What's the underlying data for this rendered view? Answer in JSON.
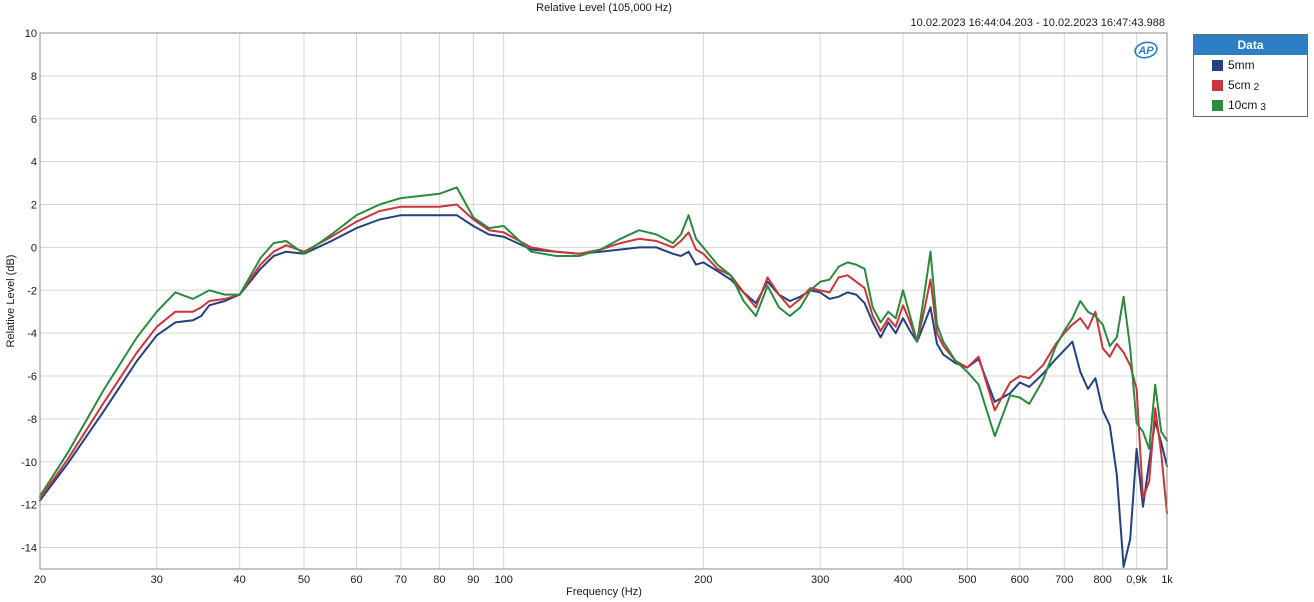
{
  "chart_data": {
    "type": "line",
    "title": "Relative Level (105,000 Hz)",
    "timestamp": "10.02.2023 16:44:04.203 - 10.02.2023 16:47:43.988",
    "xlabel": "Frequency (Hz)",
    "ylabel": "Relative Level (dB)",
    "x_scale": "log",
    "xlim": [
      20,
      1000
    ],
    "ylim": [
      -15,
      10
    ],
    "grid": true,
    "legend_position": "right",
    "legend_title": "Data",
    "x_ticks": [
      {
        "value": 20,
        "label": "20"
      },
      {
        "value": 30,
        "label": "30"
      },
      {
        "value": 40,
        "label": "40"
      },
      {
        "value": 50,
        "label": "50"
      },
      {
        "value": 60,
        "label": "60"
      },
      {
        "value": 70,
        "label": "70"
      },
      {
        "value": 80,
        "label": "80"
      },
      {
        "value": 90,
        "label": "90"
      },
      {
        "value": 100,
        "label": "100"
      },
      {
        "value": 200,
        "label": "200"
      },
      {
        "value": 300,
        "label": "300"
      },
      {
        "value": 400,
        "label": "400"
      },
      {
        "value": 500,
        "label": "500"
      },
      {
        "value": 600,
        "label": "600"
      },
      {
        "value": 700,
        "label": "700"
      },
      {
        "value": 800,
        "label": "800"
      },
      {
        "value": 900,
        "label": "0,9k"
      },
      {
        "value": 1000,
        "label": "1k"
      }
    ],
    "y_ticks": [
      10,
      8,
      6,
      4,
      2,
      0,
      -2,
      -4,
      -6,
      -8,
      -10,
      -12,
      -14
    ],
    "series": [
      {
        "name": "5mm",
        "color": "#24417f",
        "x": [
          20,
          22,
          25,
          28,
          30,
          32,
          34,
          35,
          36,
          38,
          40,
          43,
          45,
          47,
          50,
          55,
          60,
          65,
          70,
          75,
          80,
          85,
          90,
          95,
          100,
          110,
          120,
          130,
          140,
          150,
          160,
          170,
          180,
          185,
          190,
          195,
          200,
          210,
          220,
          230,
          240,
          250,
          260,
          270,
          280,
          290,
          300,
          310,
          320,
          330,
          340,
          350,
          360,
          370,
          380,
          390,
          400,
          410,
          420,
          430,
          440,
          450,
          460,
          480,
          500,
          520,
          550,
          580,
          600,
          620,
          650,
          680,
          700,
          720,
          740,
          760,
          780,
          800,
          820,
          840,
          860,
          880,
          900,
          920,
          940,
          960,
          980,
          1000
        ],
        "values": [
          -11.8,
          -10.1,
          -7.6,
          -5.3,
          -4.1,
          -3.5,
          -3.4,
          -3.2,
          -2.7,
          -2.5,
          -2.2,
          -1.0,
          -0.4,
          -0.2,
          -0.3,
          0.3,
          0.9,
          1.3,
          1.5,
          1.5,
          1.5,
          1.5,
          1.0,
          0.6,
          0.5,
          -0.1,
          -0.2,
          -0.3,
          -0.2,
          -0.1,
          0.0,
          0.0,
          -0.3,
          -0.4,
          -0.2,
          -0.8,
          -0.7,
          -1.1,
          -1.5,
          -2.1,
          -2.6,
          -1.6,
          -2.2,
          -2.5,
          -2.3,
          -2.0,
          -2.1,
          -2.4,
          -2.3,
          -2.1,
          -2.2,
          -2.6,
          -3.5,
          -4.2,
          -3.5,
          -4.0,
          -3.3,
          -3.9,
          -4.4,
          -3.6,
          -2.8,
          -4.5,
          -5.0,
          -5.4,
          -5.6,
          -5.2,
          -7.2,
          -6.8,
          -6.3,
          -6.5,
          -5.9,
          -5.2,
          -4.8,
          -4.4,
          -5.8,
          -6.6,
          -6.1,
          -7.6,
          -8.3,
          -10.6,
          -14.9,
          -13.6,
          -9.4,
          -12.1,
          -10.0,
          -8.1,
          -9.1,
          -10.2
        ]
      },
      {
        "name": "5cm",
        "color": "#c8363b",
        "x": [
          20,
          22,
          25,
          28,
          30,
          32,
          34,
          35,
          36,
          38,
          40,
          43,
          45,
          47,
          50,
          55,
          60,
          65,
          70,
          75,
          80,
          85,
          90,
          95,
          100,
          110,
          120,
          130,
          140,
          150,
          160,
          170,
          180,
          185,
          190,
          195,
          200,
          210,
          220,
          230,
          240,
          250,
          260,
          270,
          280,
          290,
          300,
          310,
          320,
          330,
          340,
          350,
          360,
          370,
          380,
          390,
          400,
          410,
          420,
          430,
          440,
          450,
          460,
          480,
          500,
          520,
          550,
          580,
          600,
          620,
          650,
          680,
          700,
          720,
          740,
          760,
          780,
          800,
          820,
          840,
          860,
          880,
          900,
          920,
          940,
          960,
          980,
          1000
        ],
        "values": [
          -11.7,
          -9.9,
          -7.2,
          -4.9,
          -3.7,
          -3.0,
          -3.0,
          -2.8,
          -2.5,
          -2.4,
          -2.2,
          -0.8,
          -0.2,
          0.1,
          -0.2,
          0.5,
          1.2,
          1.7,
          1.9,
          1.9,
          1.9,
          2.0,
          1.3,
          0.8,
          0.7,
          0.0,
          -0.2,
          -0.3,
          -0.1,
          0.2,
          0.4,
          0.3,
          0.0,
          0.3,
          0.7,
          -0.1,
          -0.3,
          -1.0,
          -1.3,
          -2.1,
          -2.8,
          -1.4,
          -2.2,
          -2.8,
          -2.4,
          -1.9,
          -2.0,
          -2.1,
          -1.4,
          -1.3,
          -1.6,
          -1.9,
          -3.2,
          -3.9,
          -3.3,
          -3.7,
          -2.7,
          -3.5,
          -4.4,
          -3.0,
          -1.5,
          -4.0,
          -4.6,
          -5.3,
          -5.6,
          -5.1,
          -7.6,
          -6.3,
          -6.0,
          -6.1,
          -5.5,
          -4.5,
          -4.0,
          -3.6,
          -3.3,
          -3.8,
          -3.0,
          -4.7,
          -5.1,
          -4.5,
          -4.9,
          -5.5,
          -6.6,
          -11.7,
          -10.9,
          -7.5,
          -9.6,
          -12.4
        ]
      },
      {
        "name": "10cm",
        "color": "#2b8a3e",
        "x": [
          20,
          22,
          25,
          28,
          30,
          32,
          34,
          35,
          36,
          38,
          40,
          43,
          45,
          47,
          50,
          55,
          60,
          65,
          70,
          75,
          80,
          85,
          90,
          95,
          100,
          110,
          120,
          130,
          140,
          150,
          160,
          170,
          180,
          185,
          190,
          195,
          200,
          210,
          220,
          230,
          240,
          250,
          260,
          270,
          280,
          290,
          300,
          310,
          320,
          330,
          340,
          350,
          360,
          370,
          380,
          390,
          400,
          410,
          420,
          430,
          440,
          450,
          460,
          480,
          500,
          520,
          550,
          580,
          600,
          620,
          650,
          680,
          700,
          720,
          740,
          760,
          780,
          800,
          820,
          840,
          860,
          880,
          900,
          920,
          940,
          960,
          980,
          1000
        ],
        "values": [
          -11.6,
          -9.6,
          -6.6,
          -4.2,
          -3.0,
          -2.1,
          -2.4,
          -2.2,
          -2.0,
          -2.2,
          -2.2,
          -0.5,
          0.2,
          0.3,
          -0.3,
          0.6,
          1.5,
          2.0,
          2.3,
          2.4,
          2.5,
          2.8,
          1.4,
          0.9,
          1.0,
          -0.2,
          -0.4,
          -0.4,
          -0.1,
          0.4,
          0.8,
          0.6,
          0.2,
          0.6,
          1.5,
          0.4,
          0.0,
          -0.8,
          -1.3,
          -2.5,
          -3.2,
          -1.8,
          -2.8,
          -3.2,
          -2.8,
          -2.0,
          -1.6,
          -1.5,
          -0.9,
          -0.7,
          -0.8,
          -1.0,
          -2.8,
          -3.5,
          -3.0,
          -3.3,
          -2.0,
          -3.2,
          -4.4,
          -2.3,
          -0.2,
          -3.6,
          -4.4,
          -5.3,
          -5.8,
          -6.4,
          -8.8,
          -6.9,
          -7.0,
          -7.3,
          -6.2,
          -4.6,
          -3.9,
          -3.3,
          -2.5,
          -3.0,
          -3.2,
          -3.6,
          -4.6,
          -4.2,
          -2.3,
          -4.7,
          -8.2,
          -8.6,
          -9.4,
          -6.4,
          -8.6,
          -9.0
        ]
      }
    ]
  }
}
